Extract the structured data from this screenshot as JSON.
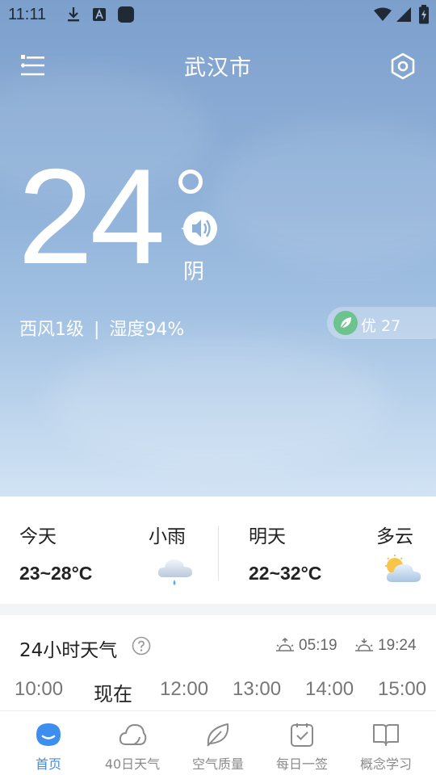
{
  "status_bar": {
    "time": "11:11"
  },
  "header": {
    "city": "武汉市"
  },
  "current": {
    "temperature": "24",
    "condition": "阴",
    "wind_humidity": {
      "wind": "西风1级",
      "separator": "|",
      "humidity": "湿度94%"
    },
    "aqi": "优 27"
  },
  "forecast": {
    "today": {
      "day": "今天",
      "condition": "小雨",
      "range": "23~28°C",
      "icon": "light-rain-icon"
    },
    "tomorrow": {
      "day": "明天",
      "condition": "多云",
      "range": "22~32°C",
      "icon": "partly-cloudy-icon"
    }
  },
  "hourly": {
    "title": "24小时天气",
    "sunrise": "05:19",
    "sunset": "19:24",
    "hours": [
      "10:00",
      "现在",
      "12:00",
      "13:00",
      "14:00",
      "15:00"
    ]
  },
  "nav": [
    {
      "label": "首页",
      "icon": "home-icon",
      "active": true
    },
    {
      "label": "40日天气",
      "icon": "cloud-icon",
      "active": false
    },
    {
      "label": "空气质量",
      "icon": "leaf-icon",
      "active": false
    },
    {
      "label": "每日一签",
      "icon": "daily-check-icon",
      "active": false
    },
    {
      "label": "概念学习",
      "icon": "book-icon",
      "active": false
    }
  ],
  "colors": {
    "accent": "#3e8ef0",
    "aqi_good": "#6cc38d",
    "sky_top": "#7c9fcc",
    "sky_bottom": "#d2e3f4"
  }
}
